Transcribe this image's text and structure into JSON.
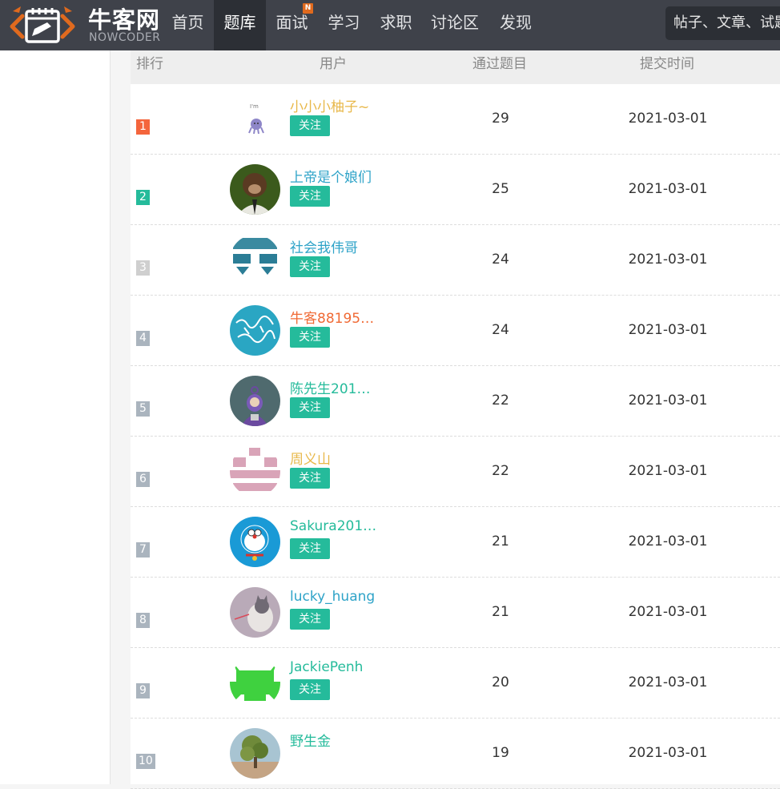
{
  "site": {
    "logo_cn": "牛客网",
    "logo_en": "NOWCODER",
    "nav": [
      {
        "label": "首页"
      },
      {
        "label": "题库",
        "active": true
      },
      {
        "label": "面试",
        "badge": "N"
      },
      {
        "label": "学习"
      },
      {
        "label": "求职"
      },
      {
        "label": "讨论区"
      },
      {
        "label": "发现"
      }
    ],
    "search_placeholder": "帖子、文章、试题"
  },
  "table": {
    "headers": {
      "rank": "排行",
      "user": "用户",
      "passed": "通过题目",
      "time": "提交时间"
    },
    "follow_label": "关注",
    "rows": [
      {
        "rank": "1",
        "name": "小小小柚子~",
        "name_color": "#e8b84a",
        "rank_color": "#f4653c",
        "passed": "29",
        "time": "2021-03-01",
        "avatar": "cartoon-octopus",
        "follow": true
      },
      {
        "rank": "2",
        "name": "上帝是个娘们",
        "name_color": "#2ea3c8",
        "rank_color": "#25bb9b",
        "passed": "25",
        "time": "2021-03-01",
        "avatar": "monkey-photo",
        "follow": true
      },
      {
        "rank": "3",
        "name": "社会我伟哥",
        "name_color": "#2ea3c8",
        "rank_color": "#cfcfcf",
        "passed": "24",
        "time": "2021-03-01",
        "avatar": "teal-block-pattern",
        "follow": true
      },
      {
        "rank": "4",
        "name": "牛客88195…",
        "name_color": "#f06a35",
        "rank_color": "#aab4be",
        "passed": "24",
        "time": "2021-03-01",
        "avatar": "calligraphy-circle",
        "follow": true
      },
      {
        "rank": "5",
        "name": "陈先生201…",
        "name_color": "#25bb9b",
        "rank_color": "#aab4be",
        "passed": "22",
        "time": "2021-03-01",
        "avatar": "teletubby",
        "follow": true
      },
      {
        "rank": "6",
        "name": "周义山",
        "name_color": "#e8b84a",
        "rank_color": "#aab4be",
        "passed": "22",
        "time": "2021-03-01",
        "avatar": "pink-block-pattern",
        "follow": true
      },
      {
        "rank": "7",
        "name": "Sakura201…",
        "name_color": "#25bb9b",
        "rank_color": "#aab4be",
        "passed": "21",
        "time": "2021-03-01",
        "avatar": "doraemon",
        "follow": true
      },
      {
        "rank": "8",
        "name": "lucky_huang",
        "name_color": "#2ea3c8",
        "rank_color": "#aab4be",
        "passed": "21",
        "time": "2021-03-01",
        "avatar": "cat-photo",
        "follow": true
      },
      {
        "rank": "9",
        "name": "JackiePenh",
        "name_color": "#25bb9b",
        "rank_color": "#aab4be",
        "passed": "20",
        "time": "2021-03-01",
        "avatar": "green-block-pattern",
        "follow": true
      },
      {
        "rank": "10",
        "name": "野生金",
        "name_color": "#25bb9b",
        "rank_color": "#aab4be",
        "passed": "19",
        "time": "2021-03-01",
        "avatar": "tree-photo",
        "follow": false
      }
    ]
  },
  "colors": {
    "topbar": "#3f424a",
    "accent": "#25bb9b",
    "logo_orange": "#e06a1e"
  }
}
